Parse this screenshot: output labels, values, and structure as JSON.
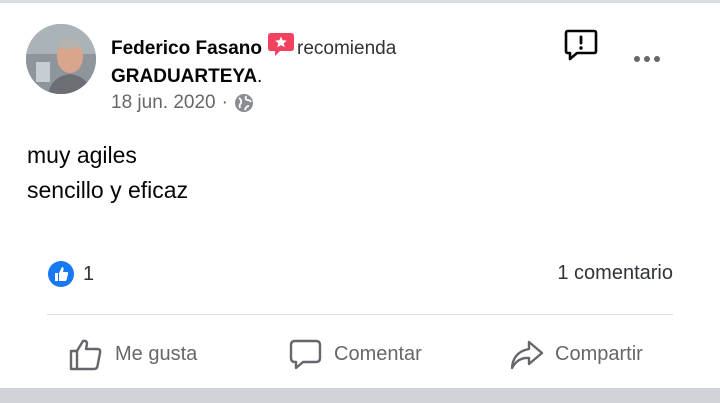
{
  "post": {
    "author_name": "Federico Fasano",
    "verb": "recomienda",
    "page_name": "GRADUARTEYA",
    "page_suffix": ".",
    "date": "18 jun. 2020",
    "separator": "·",
    "body_line1": "muy agiles",
    "body_line2": "sencillo y eficaz"
  },
  "reactions": {
    "like_count": "1",
    "comments": "1 comentario"
  },
  "actions": {
    "like_label": "Me gusta",
    "comment_label": "Comentar",
    "share_label": "Compartir"
  },
  "icons": {
    "recommend": "recommend-star-icon",
    "audience": "globe-icon",
    "report": "report-icon",
    "more": "more-options-icon",
    "like_badge": "like-badge-icon",
    "like": "thumbs-up-icon",
    "comment": "comment-bubble-icon",
    "share": "share-arrow-icon"
  },
  "colors": {
    "recommend_red": "#f3425f",
    "like_blue": "#1877f2",
    "secondary_text": "#65676b",
    "divider": "#dadde1"
  }
}
